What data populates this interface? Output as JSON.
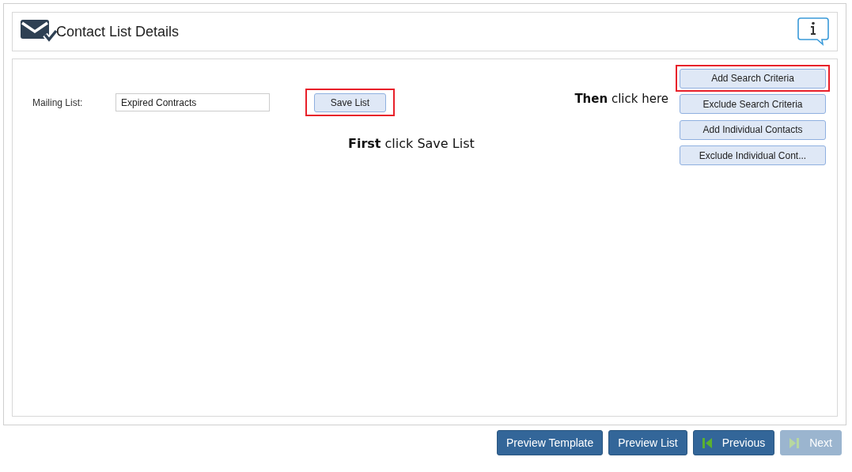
{
  "header": {
    "title": "Contact List Details"
  },
  "mailing_list": {
    "label": "Mailing List:",
    "value": "Expired Contracts"
  },
  "save_button": {
    "label": "Save List",
    "highlighted": true
  },
  "first_note": "**First** click Save List",
  "then_note": "**Then** click here",
  "criteria_buttons": [
    {
      "label": "Add Search Criteria",
      "highlighted": true
    },
    {
      "label": "Exclude Search Criteria",
      "highlighted": false
    },
    {
      "label": "Add Individual Contacts",
      "highlighted": false
    },
    {
      "label": "Exclude Individual Cont...",
      "highlighted": false
    }
  ],
  "footer_buttons": [
    {
      "label": "Preview Template",
      "kind": "plain",
      "disabled": false
    },
    {
      "label": "Preview List",
      "kind": "plain",
      "disabled": false
    },
    {
      "label": "Previous",
      "kind": "previous",
      "disabled": false
    },
    {
      "label": "Next",
      "kind": "next",
      "disabled": true
    }
  ]
}
